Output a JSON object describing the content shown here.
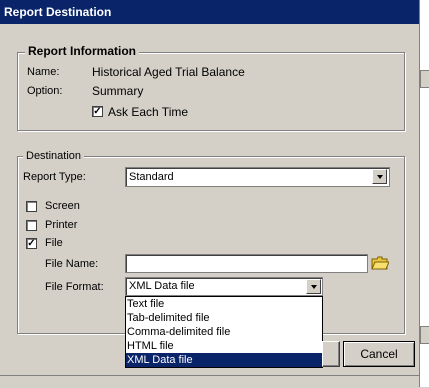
{
  "window": {
    "title": "Report Destination"
  },
  "report_info": {
    "legend": "Report Information",
    "name_label": "Name:",
    "name_value": "Historical Aged Trial Balance",
    "option_label": "Option:",
    "option_value": "Summary",
    "ask_each_time_label": "Ask Each Time",
    "ask_each_time_checked": true
  },
  "destination": {
    "legend": "Destination",
    "report_type_label": "Report Type:",
    "report_type_value": "Standard",
    "screen_label": "Screen",
    "screen_checked": false,
    "printer_label": "Printer",
    "printer_checked": false,
    "file_label": "File",
    "file_checked": true,
    "file_name_label": "File Name:",
    "file_name_value": "",
    "file_format_label": "File Format:",
    "file_format_value": "XML Data file",
    "file_format_options": [
      "Text file",
      "Tab-delimited file",
      "Comma-delimited file",
      "HTML file",
      "XML Data file"
    ],
    "file_format_selected_index": 4
  },
  "buttons": {
    "cancel_label": "Cancel"
  },
  "icons": {
    "browse": "folder-icon",
    "dropdown": "chevron-down-icon"
  },
  "colors": {
    "title_bar": "#0a246a",
    "selection": "#0a246a",
    "face": "#d4d0c8"
  }
}
